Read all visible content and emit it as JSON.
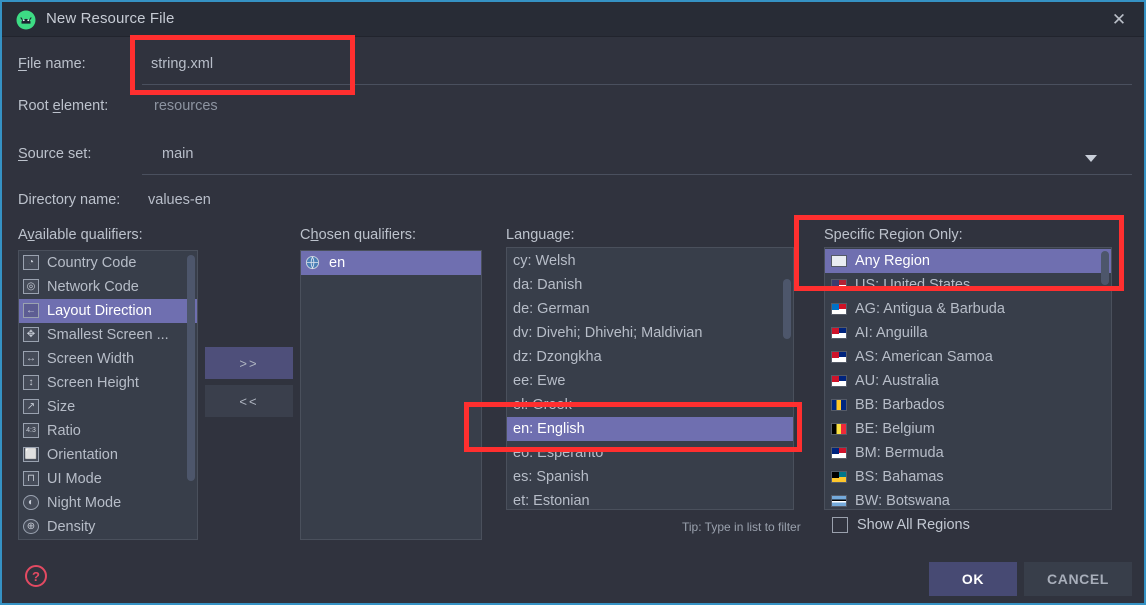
{
  "window": {
    "title": "New Resource File",
    "app_icon": "android-studio-icon",
    "close_icon": "close-icon",
    "accent_border": "#3592c4",
    "bg": "#30333e",
    "titlebar_bg": "#282c36",
    "selection_color": "#6f6fb0",
    "annotation_color": "#ff2f2f"
  },
  "form": {
    "file_name": {
      "label": "File name:",
      "mnemonic": "F",
      "value": "string.xml"
    },
    "root_element": {
      "label": "Root element:",
      "mnemonic": "e",
      "value": "resources"
    },
    "source_set": {
      "label": "Source set:",
      "mnemonic": "S",
      "value": "main",
      "dropdown_icon": "chevron-down-icon"
    },
    "directory_name": {
      "label": "Directory name:",
      "value": "values-en"
    }
  },
  "available_qualifiers": {
    "label": "Available qualifiers:",
    "mnemonic": "v",
    "items": [
      {
        "label": "Country Code",
        "icon": "country-code-icon",
        "glyph": "◔",
        "selected": false
      },
      {
        "label": "Network Code",
        "icon": "network-code-icon",
        "glyph": "◎",
        "selected": false
      },
      {
        "label": "Layout Direction",
        "icon": "layout-direction-icon",
        "glyph": "←",
        "selected": true
      },
      {
        "label": "Smallest Screen ...",
        "icon": "smallest-screen-icon",
        "glyph": "✥",
        "selected": false
      },
      {
        "label": "Screen Width",
        "icon": "screen-width-icon",
        "glyph": "↔",
        "selected": false
      },
      {
        "label": "Screen Height",
        "icon": "screen-height-icon",
        "glyph": "↕",
        "selected": false
      },
      {
        "label": "Size",
        "icon": "size-icon",
        "glyph": "↗",
        "selected": false
      },
      {
        "label": "Ratio",
        "icon": "ratio-icon",
        "glyph": "4:3",
        "selected": false
      },
      {
        "label": "Orientation",
        "icon": "orientation-icon",
        "glyph": "⬜",
        "selected": false
      },
      {
        "label": "UI Mode",
        "icon": "ui-mode-icon",
        "glyph": "⊓",
        "selected": false
      },
      {
        "label": "Night Mode",
        "icon": "night-mode-icon",
        "glyph": "◐",
        "selected": false
      },
      {
        "label": "Density",
        "icon": "density-icon",
        "glyph": "⊕",
        "selected": false
      }
    ]
  },
  "chosen_qualifiers": {
    "label": "Chosen qualifiers:",
    "mnemonic": "h",
    "items": [
      {
        "label": "en",
        "icon": "globe-icon",
        "selected": true
      }
    ]
  },
  "transfer_buttons": {
    "add_label": ">>",
    "remove_label": "<<"
  },
  "language_list": {
    "label": "Language:",
    "items": [
      {
        "label": "cy: Welsh",
        "selected": false,
        "occluded": false
      },
      {
        "label": "da: Danish",
        "selected": false,
        "occluded": false
      },
      {
        "label": "de: German",
        "selected": false,
        "occluded": false
      },
      {
        "label": "dv: Divehi; Dhivehi; Maldivian",
        "selected": false,
        "occluded": false
      },
      {
        "label": "dz: Dzongkha",
        "selected": false,
        "occluded": false
      },
      {
        "label": "ee: Ewe",
        "selected": false,
        "occluded": false
      },
      {
        "label": "el: Greek",
        "selected": false,
        "occluded": true
      },
      {
        "label": "en: English",
        "selected": true,
        "occluded": false
      },
      {
        "label": "eo: Esperanto",
        "selected": false,
        "occluded": true
      },
      {
        "label": "es: Spanish",
        "selected": false,
        "occluded": false
      },
      {
        "label": "et: Estonian",
        "selected": false,
        "occluded": false
      }
    ]
  },
  "region_list": {
    "label": "Specific Region Only:",
    "items": [
      {
        "label": "Any Region",
        "icon": "blank-flag-icon",
        "selected": true,
        "occluded": false
      },
      {
        "label": "US: United States",
        "icon": "flag-us-icon",
        "selected": false,
        "occluded": true
      },
      {
        "label": "AG: Antigua & Barbuda",
        "icon": "flag-ag-icon",
        "selected": false,
        "occluded": false
      },
      {
        "label": "AI: Anguilla",
        "icon": "flag-ai-icon",
        "selected": false,
        "occluded": false
      },
      {
        "label": "AS: American Samoa",
        "icon": "flag-as-icon",
        "selected": false,
        "occluded": false
      },
      {
        "label": "AU: Australia",
        "icon": "flag-au-icon",
        "selected": false,
        "occluded": false
      },
      {
        "label": "BB: Barbados",
        "icon": "flag-bb-icon",
        "selected": false,
        "occluded": false
      },
      {
        "label": "BE: Belgium",
        "icon": "flag-be-icon",
        "selected": false,
        "occluded": false
      },
      {
        "label": "BM: Bermuda",
        "icon": "flag-bm-icon",
        "selected": false,
        "occluded": false
      },
      {
        "label": "BS: Bahamas",
        "icon": "flag-bs-icon",
        "selected": false,
        "occluded": false
      },
      {
        "label": "BW: Botswana",
        "icon": "flag-bw-icon",
        "selected": false,
        "occluded": false
      }
    ]
  },
  "tip": "Tip: Type in list to filter",
  "show_all_regions": {
    "label": "Show All Regions",
    "checked": false
  },
  "footer": {
    "help_icon": "help-icon",
    "help_glyph": "?",
    "ok_label": "OK",
    "cancel_label": "CANCEL"
  }
}
